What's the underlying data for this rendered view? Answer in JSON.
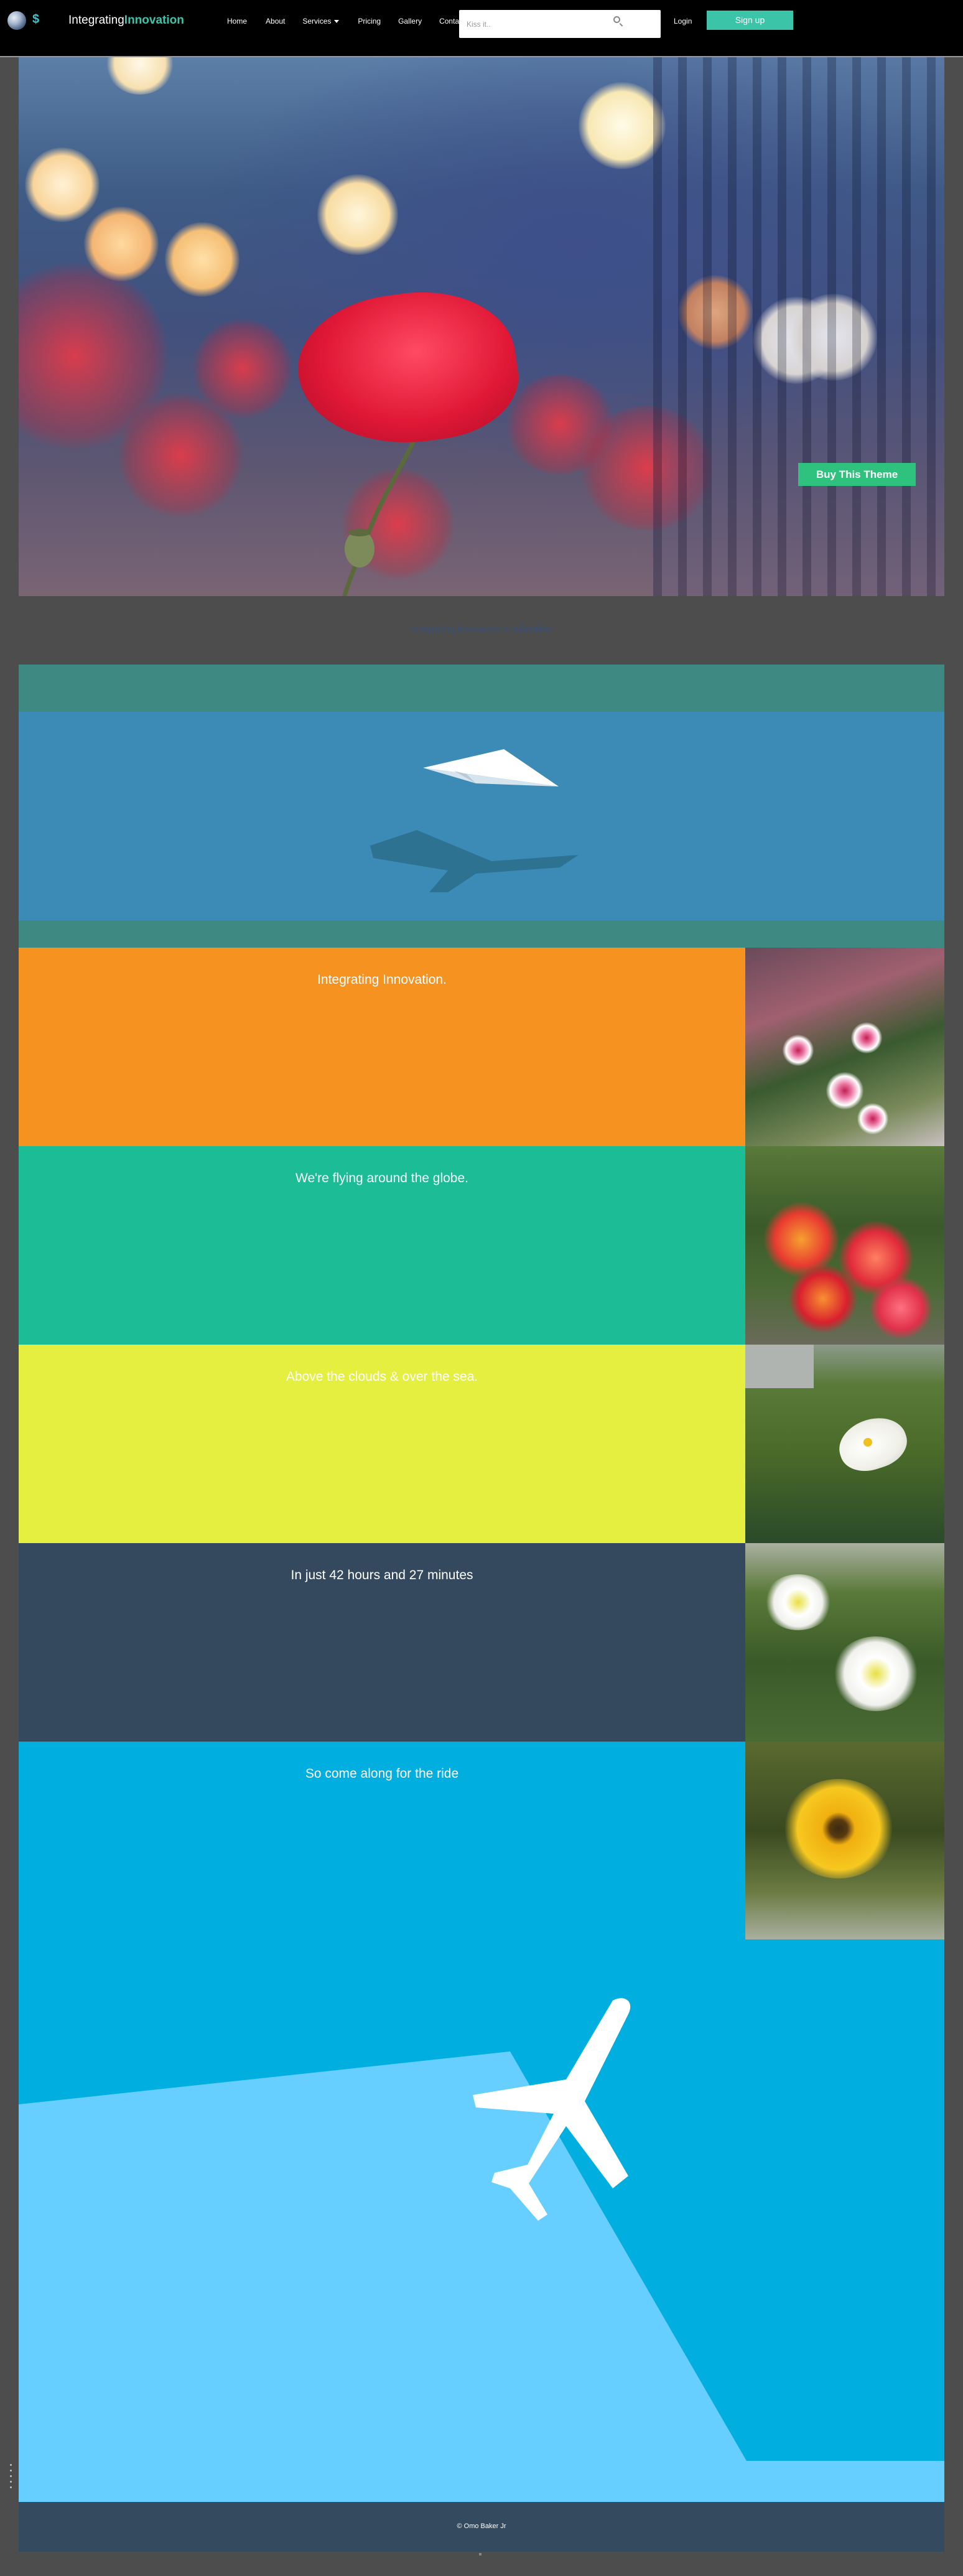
{
  "nav": {
    "brand_first": "Integrating",
    "brand_second": "Innovation",
    "dollar": "$",
    "links": {
      "home": "Home",
      "about": "About",
      "services": "Services",
      "pricing": "Pricing",
      "gallery": "Gallery",
      "contact": "Contact"
    },
    "search_placeholder": "Kiss it..",
    "login": "Login",
    "signup": "Sign up"
  },
  "hero": {
    "buy_button": "Buy This Theme"
  },
  "sublink": "Integrating Innovation in education",
  "rows": [
    {
      "caption": "Integrating Innovation.",
      "bg": "#f69320",
      "photo": "pink-periwinkle-flowers"
    },
    {
      "caption": "We're flying around the globe.",
      "bg": "#1bbc96",
      "photo": "red-orange-lantana"
    },
    {
      "caption": "Above the clouds & over the sea.",
      "bg": "#e4ef40",
      "photo": "white-calla-lily"
    },
    {
      "caption": "In just 42 hours and 27 minutes",
      "bg": "#34495e",
      "photo": "white-lilies"
    },
    {
      "caption": "So come along for the ride",
      "bg": "#00aee0",
      "photo": "yellow-gazania"
    }
  ],
  "footer": {
    "copyright": "© Omo Baker Jr"
  },
  "colors": {
    "accent": "#3cc4a8",
    "buy": "#2ec27e",
    "banner_sky": "#3c8ab6",
    "banner_band": "#3e8a82",
    "plane_section": "#00aee0",
    "plane_light": "#66cfff",
    "footer": "#344a5f"
  }
}
